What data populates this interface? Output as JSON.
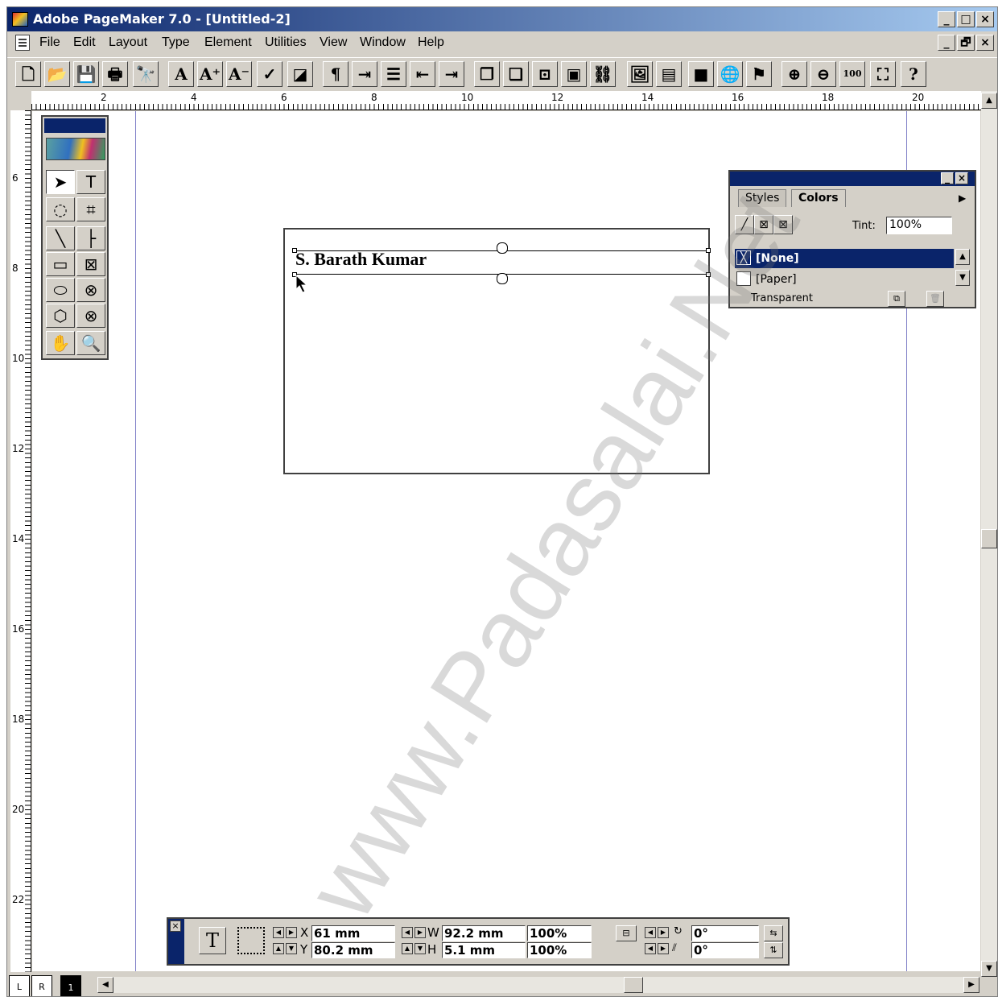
{
  "window": {
    "title": "Adobe PageMaker 7.0 - [Untitled-2]",
    "min_label": "_",
    "max_label": "□",
    "close_label": "×",
    "restore_label": "🗗"
  },
  "menubar": {
    "items": [
      "File",
      "Edit",
      "Layout",
      "Type",
      "Element",
      "Utilities",
      "View",
      "Window",
      "Help"
    ]
  },
  "toolbar": {
    "buttons": [
      {
        "icon": "new-document-icon",
        "glyph": "🗋"
      },
      {
        "icon": "open-folder-icon",
        "glyph": "📂"
      },
      {
        "icon": "save-icon",
        "glyph": "💾"
      },
      {
        "icon": "print-icon",
        "glyph": "🖶"
      },
      {
        "icon": "find-icon",
        "glyph": "🔭"
      },
      {
        "icon": "font-icon",
        "glyph": "A"
      },
      {
        "icon": "font-size-up-icon",
        "glyph": "A⁺"
      },
      {
        "icon": "font-size-down-icon",
        "glyph": "A⁻"
      },
      {
        "icon": "spelling-icon",
        "glyph": "✓"
      },
      {
        "icon": "fill-stroke-icon",
        "glyph": "◪"
      },
      {
        "icon": "paragraph-icon",
        "glyph": "¶"
      },
      {
        "icon": "indents-tabs-icon",
        "glyph": "⇥"
      },
      {
        "icon": "bullets-icon",
        "glyph": "☰"
      },
      {
        "icon": "decrease-indent-icon",
        "glyph": "⇤"
      },
      {
        "icon": "increase-indent-icon",
        "glyph": "⇥"
      },
      {
        "icon": "pages-icon",
        "glyph": "❐"
      },
      {
        "icon": "copy-pages-icon",
        "glyph": "❏"
      },
      {
        "icon": "frame-icon",
        "glyph": "⊡"
      },
      {
        "icon": "mask-icon",
        "glyph": "▣"
      },
      {
        "icon": "link-icon",
        "glyph": "⛓"
      },
      {
        "icon": "place-image-icon",
        "glyph": "🖼"
      },
      {
        "icon": "image-export-icon",
        "glyph": "▤"
      },
      {
        "icon": "photo-icon",
        "glyph": "■"
      },
      {
        "icon": "globe-icon",
        "glyph": "🌐"
      },
      {
        "icon": "pdf-icon",
        "glyph": "⚑"
      },
      {
        "icon": "zoom-in-icon",
        "glyph": "⊕"
      },
      {
        "icon": "zoom-out-icon",
        "glyph": "⊖"
      },
      {
        "icon": "actual-size-icon",
        "glyph": "100"
      },
      {
        "icon": "fit-window-icon",
        "glyph": "⛶"
      },
      {
        "icon": "help-icon",
        "glyph": "?"
      }
    ]
  },
  "rulers": {
    "horizontal": [
      "2",
      "4",
      "6",
      "8",
      "10",
      "12",
      "14",
      "16",
      "18",
      "20"
    ],
    "vertical": [
      "6",
      "8",
      "10",
      "12",
      "14",
      "16",
      "18",
      "20",
      "22"
    ]
  },
  "toolbox": {
    "tools": [
      {
        "name": "pointer-tool",
        "glyph": "➤"
      },
      {
        "name": "text-tool",
        "glyph": "T"
      },
      {
        "name": "rotate-tool",
        "glyph": "◌"
      },
      {
        "name": "crop-tool",
        "glyph": "⌗"
      },
      {
        "name": "line-tool",
        "glyph": "╲"
      },
      {
        "name": "constrained-line-tool",
        "glyph": "├"
      },
      {
        "name": "rectangle-tool",
        "glyph": "▭"
      },
      {
        "name": "rectangle-frame-tool",
        "glyph": "⊠"
      },
      {
        "name": "ellipse-tool",
        "glyph": "⬭"
      },
      {
        "name": "ellipse-frame-tool",
        "glyph": "⊗"
      },
      {
        "name": "polygon-tool",
        "glyph": "⬡"
      },
      {
        "name": "polygon-frame-tool",
        "glyph": "⊗"
      },
      {
        "name": "hand-tool",
        "glyph": "✋"
      },
      {
        "name": "zoom-tool",
        "glyph": "🔍"
      }
    ]
  },
  "document": {
    "text": "S. Barath Kumar"
  },
  "colors_panel": {
    "tabs": [
      "Styles",
      "Colors"
    ],
    "tint_label": "Tint:",
    "tint_value": "100%",
    "rows": [
      "[None]",
      "[Paper]"
    ],
    "status": "Transparent"
  },
  "control_palette": {
    "x_label": "X",
    "y_label": "Y",
    "w_label": "W",
    "h_label": "H",
    "x": "61 mm",
    "y": "80.2 mm",
    "w": "92.2 mm",
    "h": "5.1 mm",
    "scale_w": "100%",
    "scale_h": "100%",
    "rotation": "0°",
    "skew": "0°",
    "tool_glyph": "T"
  },
  "pages": {
    "left": "L",
    "right": "R",
    "current": "1"
  },
  "watermark": "www.Padasalai.Net"
}
